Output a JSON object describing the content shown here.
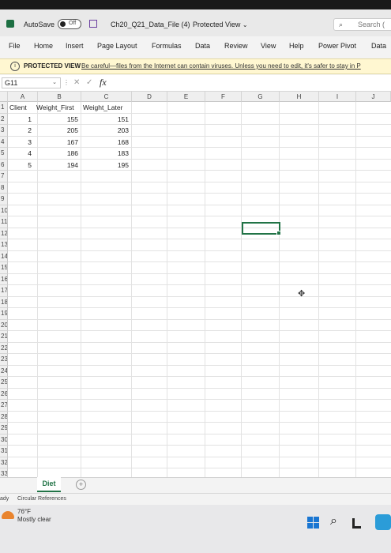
{
  "titlebar": {
    "autosave_label": "AutoSave",
    "autosave_state": "Off",
    "file_name": "Ch20_Q21_Data_File (4)",
    "separator": "-",
    "mode": "Protected View",
    "mode_chevron": "⌄",
    "search_placeholder": "Search (",
    "search_icon": "⌕"
  },
  "menu": {
    "items": [
      "File",
      "Home",
      "Insert",
      "Page Layout",
      "Formulas",
      "Data",
      "Review",
      "View",
      "Help",
      "Power Pivot",
      "Data"
    ]
  },
  "protected_bar": {
    "icon": "i",
    "title": "PROTECTED VIEW",
    "message": "Be careful—files from the Internet can contain viruses. Unless you need to edit, it's safer to stay in P"
  },
  "formula_bar": {
    "name_box": "G11",
    "name_box_arrow": "⌄",
    "dots": "⋮",
    "cancel": "✕",
    "enter": "✓",
    "fx": "fx",
    "formula": ""
  },
  "sheet": {
    "columns": [
      "A",
      "B",
      "C",
      "D",
      "E",
      "F",
      "G",
      "H",
      "I",
      "J"
    ],
    "row_numbers": [
      "1",
      "2",
      "3",
      "4",
      "5",
      "6",
      "7",
      "8",
      "9",
      "10",
      "11",
      "12",
      "13",
      "14",
      "15",
      "16",
      "17",
      "18",
      "19",
      "20",
      "21",
      "22",
      "23",
      "24",
      "25",
      "26",
      "27",
      "28",
      "29",
      "30",
      "31",
      "32",
      "33"
    ],
    "header_row": [
      "Client",
      "Weight_First",
      "Weight_Later"
    ],
    "rows": [
      [
        "1",
        "155",
        "151"
      ],
      [
        "2",
        "205",
        "203"
      ],
      [
        "3",
        "167",
        "168"
      ],
      [
        "4",
        "186",
        "183"
      ],
      [
        "5",
        "194",
        "195"
      ]
    ],
    "selected_cell": "G11",
    "cursor_icon": "✥"
  },
  "tabs": {
    "active": "Diet",
    "add_icon": "+"
  },
  "status": {
    "ready": "ady",
    "circular": "Circular References"
  },
  "taskbar": {
    "temperature": "76°F",
    "condition": "Mostly clear",
    "search_icon": "⌕"
  },
  "colors": {
    "excel_green": "#217346",
    "protected_bar": "#fff7d1",
    "windows_blue": "#1a76d2"
  }
}
